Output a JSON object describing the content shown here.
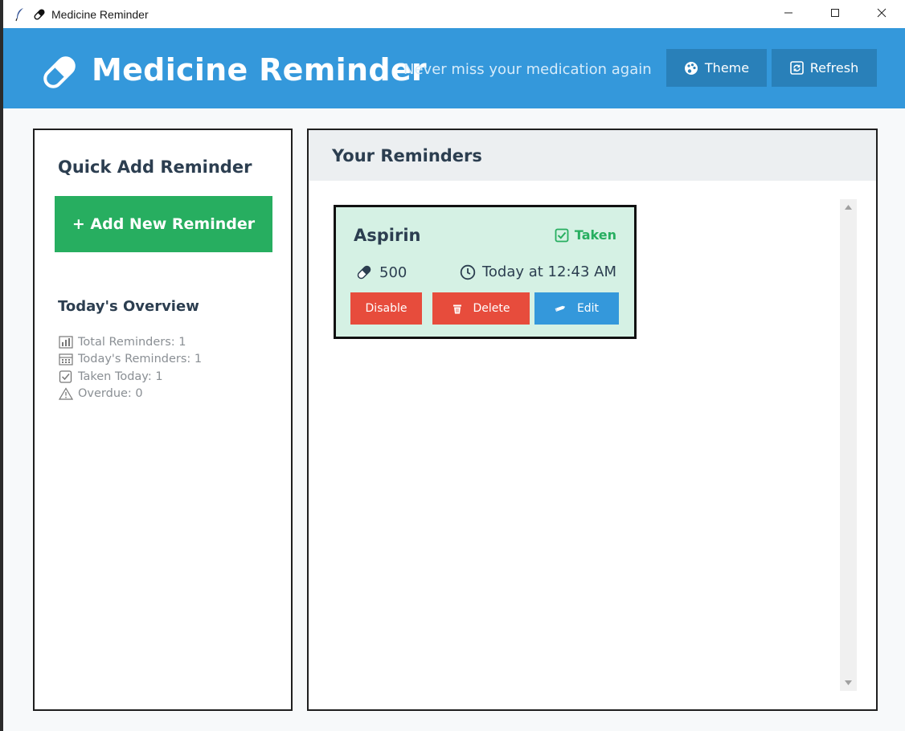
{
  "window": {
    "title": "Medicine Reminder"
  },
  "header": {
    "app_title": "Medicine Reminder",
    "subtitle": "Never miss your medication again",
    "theme_label": "Theme",
    "refresh_label": "Refresh"
  },
  "quick_add": {
    "title": "Quick Add Reminder",
    "add_button_label": "+ Add New Reminder"
  },
  "overview": {
    "title": "Today's Overview",
    "items": [
      {
        "icon": "bar-chart-icon",
        "label": "Total Reminders: 1"
      },
      {
        "icon": "calendar-icon",
        "label": "Today's Reminders: 1"
      },
      {
        "icon": "checkbox-icon",
        "label": "Taken Today: 1"
      },
      {
        "icon": "warning-icon",
        "label": "Overdue: 0"
      }
    ]
  },
  "reminders": {
    "title": "Your Reminders",
    "items": [
      {
        "name": "Aspirin",
        "status": "Taken",
        "dosage": "500",
        "schedule": "Today at 12:43 AM",
        "disable_label": "Disable",
        "delete_label": "Delete",
        "edit_label": "Edit"
      }
    ]
  },
  "colors": {
    "header_bg": "#3498db",
    "header_button_bg": "#2980b9",
    "add_button_bg": "#27ae60",
    "card_bg": "#d5f1e4",
    "taken_text": "#27ae60",
    "danger": "#e74c3c",
    "primary": "#3498db",
    "heading_text": "#2c3e50"
  }
}
